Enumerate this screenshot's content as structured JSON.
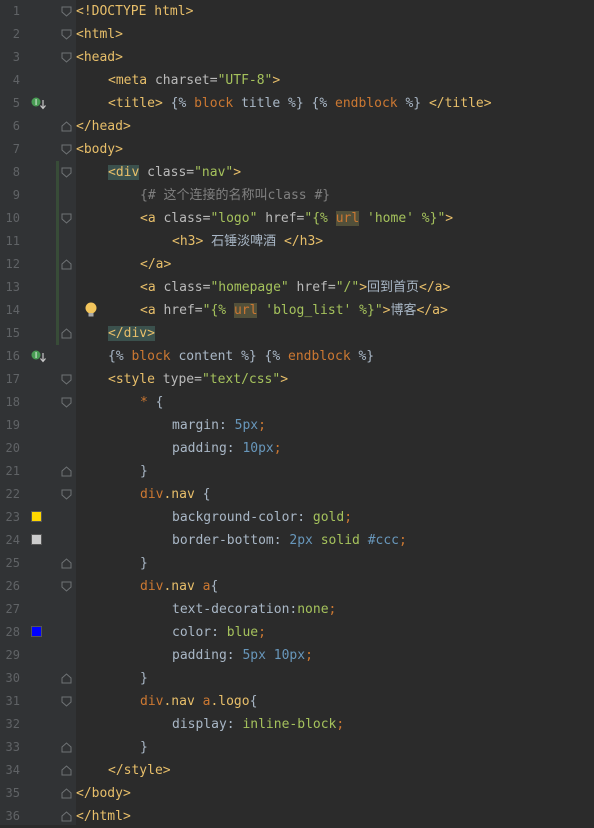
{
  "editor": {
    "lines": [
      {
        "n": "1",
        "segs": [
          [
            "tag",
            "<!DOCTYPE html>"
          ]
        ],
        "indent": 0,
        "fold": "open"
      },
      {
        "n": "2",
        "segs": [
          [
            "tag",
            "<html>"
          ]
        ],
        "indent": 0,
        "fold": "open"
      },
      {
        "n": "3",
        "segs": [
          [
            "tag",
            "<head>"
          ]
        ],
        "indent": 0,
        "fold": "open"
      },
      {
        "n": "4",
        "segs": [
          [
            "tag",
            "<meta "
          ],
          [
            "attr",
            "charset="
          ],
          [
            "str",
            "\"UTF-8\""
          ],
          [
            "tag",
            ">"
          ]
        ],
        "indent": 1
      },
      {
        "n": "5",
        "segs": [
          [
            "tag",
            "<title>"
          ],
          [
            "tpl",
            " {% "
          ],
          [
            "kw",
            "block"
          ],
          [
            "tpl",
            " title %} {% "
          ],
          [
            "kw",
            "endblock"
          ],
          [
            "tpl",
            " %} "
          ],
          [
            "tag",
            "</title>"
          ]
        ],
        "indent": 1,
        "gutter": "override-icon"
      },
      {
        "n": "6",
        "segs": [
          [
            "tag",
            "</head>"
          ]
        ],
        "indent": 0,
        "fold": "close"
      },
      {
        "n": "7",
        "segs": [
          [
            "tag",
            "<body>"
          ]
        ],
        "indent": 0,
        "fold": "open"
      },
      {
        "n": "8",
        "segs": [
          [
            "hltag",
            "<div"
          ],
          [
            "attr",
            " class="
          ],
          [
            "str",
            "\"nav\""
          ],
          [
            "tag",
            ">"
          ]
        ],
        "indent": 1,
        "fold": "open"
      },
      {
        "n": "9",
        "segs": [
          [
            "cmt",
            "{# 这个连接的名称叫class #}"
          ]
        ],
        "indent": 2
      },
      {
        "n": "10",
        "segs": [
          [
            "tag",
            "<a "
          ],
          [
            "attr",
            "class="
          ],
          [
            "str",
            "\"logo\""
          ],
          [
            "attr",
            " href="
          ],
          [
            "str",
            "\"{% "
          ],
          [
            "hlurl",
            "url"
          ],
          [
            "str",
            " 'home' %}\""
          ],
          [
            "tag",
            ">"
          ]
        ],
        "indent": 2,
        "fold": "open"
      },
      {
        "n": "11",
        "segs": [
          [
            "tag",
            "<h3>"
          ],
          [
            "plain",
            " 石锤淡啤酒 "
          ],
          [
            "tag",
            "</h3>"
          ]
        ],
        "indent": 3
      },
      {
        "n": "12",
        "segs": [
          [
            "tag",
            "</a>"
          ]
        ],
        "indent": 2,
        "fold": "close"
      },
      {
        "n": "13",
        "segs": [
          [
            "tag",
            "<a "
          ],
          [
            "attr",
            "class="
          ],
          [
            "str",
            "\"homepage\""
          ],
          [
            "attr",
            " href="
          ],
          [
            "str",
            "\"/\""
          ],
          [
            "tag",
            ">"
          ],
          [
            "plain",
            "回到首页"
          ],
          [
            "tag",
            "</a>"
          ]
        ],
        "indent": 2
      },
      {
        "n": "14",
        "segs": [
          [
            "tag",
            "<a "
          ],
          [
            "attr",
            "href="
          ],
          [
            "str",
            "\"{% "
          ],
          [
            "hlurl",
            "url"
          ],
          [
            "str",
            " 'blog_list' %}\""
          ],
          [
            "tag",
            ">"
          ],
          [
            "plain",
            "博客"
          ],
          [
            "tag",
            "</a>"
          ]
        ],
        "indent": 2,
        "gutter": "bulb-icon"
      },
      {
        "n": "15",
        "segs": [
          [
            "hltag",
            "</div>"
          ]
        ],
        "indent": 1,
        "fold": "close"
      },
      {
        "n": "16",
        "segs": [
          [
            "tpl",
            "{% "
          ],
          [
            "kw",
            "block"
          ],
          [
            "tpl",
            " content %} {% "
          ],
          [
            "kw",
            "endblock"
          ],
          [
            "tpl",
            " %}"
          ]
        ],
        "indent": 1,
        "gutter": "override-icon"
      },
      {
        "n": "17",
        "segs": [
          [
            "tag",
            "<style "
          ],
          [
            "attr",
            "type="
          ],
          [
            "str",
            "\"text/css\""
          ],
          [
            "tag",
            ">"
          ]
        ],
        "indent": 1,
        "fold": "open"
      },
      {
        "n": "18",
        "segs": [
          [
            "kw",
            "*"
          ],
          [
            "plain",
            " {"
          ]
        ],
        "indent": 2,
        "fold": "open"
      },
      {
        "n": "19",
        "segs": [
          [
            "prop",
            "margin"
          ],
          [
            "plain",
            ": "
          ],
          [
            "num",
            "5px"
          ],
          [
            "kw",
            ";"
          ]
        ],
        "indent": 3
      },
      {
        "n": "20",
        "segs": [
          [
            "prop",
            "padding"
          ],
          [
            "plain",
            ": "
          ],
          [
            "num",
            "10px"
          ],
          [
            "kw",
            ";"
          ]
        ],
        "indent": 3
      },
      {
        "n": "21",
        "segs": [
          [
            "plain",
            "}"
          ]
        ],
        "indent": 2,
        "fold": "close"
      },
      {
        "n": "22",
        "segs": [
          [
            "kw",
            "div"
          ],
          [
            "tag",
            ".nav"
          ],
          [
            "plain",
            " {"
          ]
        ],
        "indent": 2,
        "fold": "open"
      },
      {
        "n": "23",
        "segs": [
          [
            "prop",
            "background-color"
          ],
          [
            "plain",
            ": "
          ],
          [
            "val",
            "gold"
          ],
          [
            "kw",
            ";"
          ]
        ],
        "indent": 3,
        "swatch": "#ffd700"
      },
      {
        "n": "24",
        "segs": [
          [
            "prop",
            "border-bottom"
          ],
          [
            "plain",
            ": "
          ],
          [
            "num",
            "2px"
          ],
          [
            "val",
            " solid "
          ],
          [
            "num",
            "#ccc"
          ],
          [
            "kw",
            ";"
          ]
        ],
        "indent": 3,
        "swatch": "#cccccc"
      },
      {
        "n": "25",
        "segs": [
          [
            "plain",
            "}"
          ]
        ],
        "indent": 2,
        "fold": "close"
      },
      {
        "n": "26",
        "segs": [
          [
            "kw",
            "div"
          ],
          [
            "tag",
            ".nav"
          ],
          [
            "kw",
            " a"
          ],
          [
            "plain",
            "{"
          ]
        ],
        "indent": 2,
        "fold": "open"
      },
      {
        "n": "27",
        "segs": [
          [
            "prop",
            "text-decoration"
          ],
          [
            "plain",
            ":"
          ],
          [
            "val",
            "none"
          ],
          [
            "kw",
            ";"
          ]
        ],
        "indent": 3
      },
      {
        "n": "28",
        "segs": [
          [
            "prop",
            "color"
          ],
          [
            "plain",
            ": "
          ],
          [
            "val",
            "blue"
          ],
          [
            "kw",
            ";"
          ]
        ],
        "indent": 3,
        "swatch": "#0000ff"
      },
      {
        "n": "29",
        "segs": [
          [
            "prop",
            "padding"
          ],
          [
            "plain",
            ": "
          ],
          [
            "num",
            "5px 10px"
          ],
          [
            "kw",
            ";"
          ]
        ],
        "indent": 3
      },
      {
        "n": "30",
        "segs": [
          [
            "plain",
            "}"
          ]
        ],
        "indent": 2,
        "fold": "close"
      },
      {
        "n": "31",
        "segs": [
          [
            "kw",
            "div"
          ],
          [
            "tag",
            ".nav"
          ],
          [
            "kw",
            " a"
          ],
          [
            "tag",
            ".logo"
          ],
          [
            "plain",
            "{"
          ]
        ],
        "indent": 2,
        "fold": "open"
      },
      {
        "n": "32",
        "segs": [
          [
            "prop",
            "display"
          ],
          [
            "plain",
            ": "
          ],
          [
            "val",
            "inline-block"
          ],
          [
            "kw",
            ";"
          ]
        ],
        "indent": 3
      },
      {
        "n": "33",
        "segs": [
          [
            "plain",
            "}"
          ]
        ],
        "indent": 2,
        "fold": "close"
      },
      {
        "n": "34",
        "segs": [
          [
            "tag",
            "</style>"
          ]
        ],
        "indent": 1,
        "fold": "close"
      },
      {
        "n": "35",
        "segs": [
          [
            "tag",
            "</body>"
          ]
        ],
        "indent": 0,
        "fold": "close"
      },
      {
        "n": "36",
        "segs": [
          [
            "tag",
            "</html>"
          ]
        ],
        "indent": 0,
        "fold": "close"
      }
    ]
  }
}
